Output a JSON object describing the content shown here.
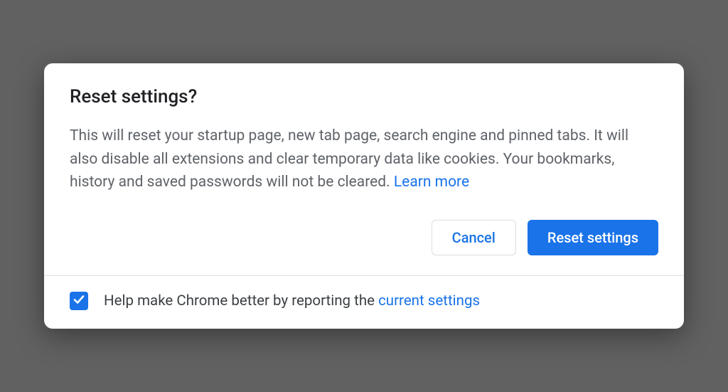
{
  "dialog": {
    "title": "Reset settings?",
    "body_text": "This will reset your startup page, new tab page, search engine and pinned tabs. It will also disable all extensions and clear temporary data like cookies. Your bookmarks, history and saved passwords will not be cleared. ",
    "learn_more": "Learn more",
    "cancel_label": "Cancel",
    "confirm_label": "Reset settings"
  },
  "footer": {
    "checkbox_checked": true,
    "text_prefix": "Help make Chrome better by reporting the ",
    "link_text": "current settings"
  }
}
